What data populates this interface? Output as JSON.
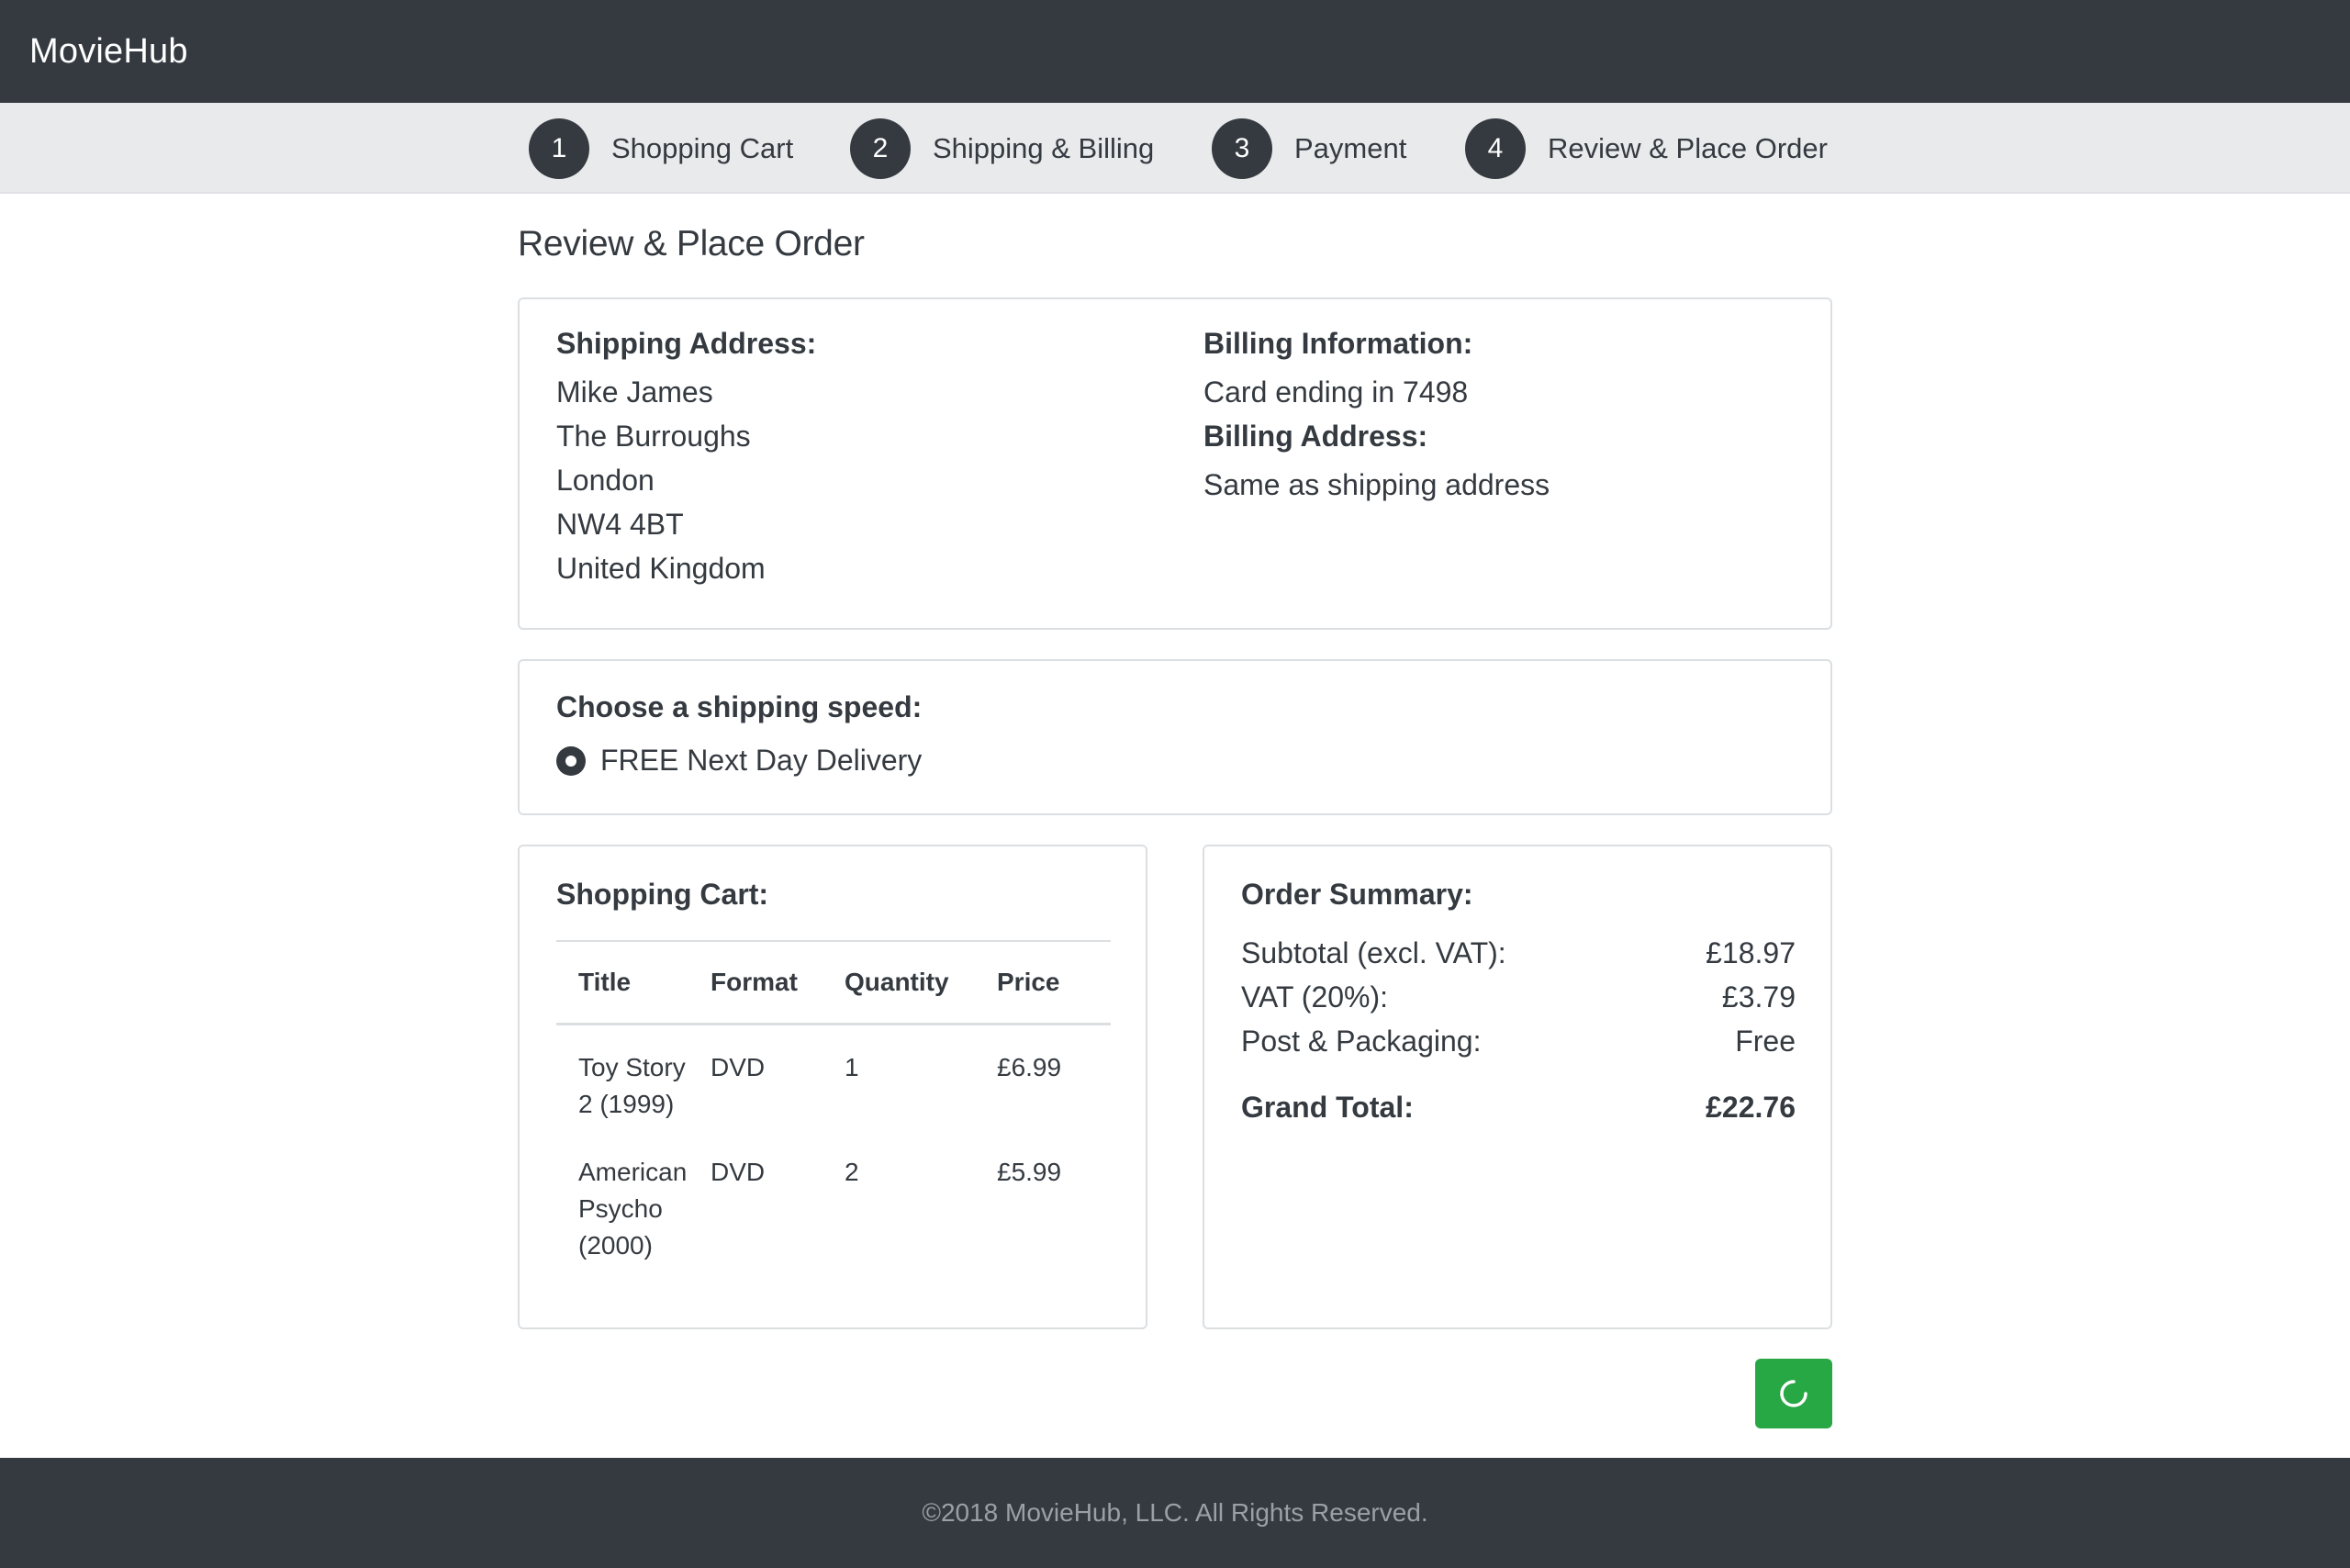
{
  "navbar": {
    "brand": "MovieHub"
  },
  "steps": [
    {
      "number": "1",
      "label": "Shopping Cart"
    },
    {
      "number": "2",
      "label": "Shipping & Billing"
    },
    {
      "number": "3",
      "label": "Payment"
    },
    {
      "number": "4",
      "label": "Review & Place Order"
    }
  ],
  "page": {
    "title": "Review & Place Order"
  },
  "shipping": {
    "heading": "Shipping Address:",
    "lines": [
      "Mike James",
      "The Burroughs",
      "London",
      "NW4 4BT",
      "United Kingdom"
    ]
  },
  "billing": {
    "heading": "Billing Information:",
    "card": "Card ending in 7498",
    "address_heading": "Billing Address:",
    "address": "Same as shipping address"
  },
  "speed": {
    "heading": "Choose a shipping speed:",
    "option": "FREE Next Day Delivery",
    "selected": true
  },
  "cart": {
    "heading": "Shopping Cart:",
    "columns": [
      "Title",
      "Format",
      "Quantity",
      "Price"
    ],
    "rows": [
      {
        "title_lines": [
          "Toy Story",
          "2 (1999)"
        ],
        "format": "DVD",
        "quantity": "1",
        "price": "£6.99"
      },
      {
        "title_lines": [
          "American",
          "Psycho",
          "(2000)"
        ],
        "format": "DVD",
        "quantity": "2",
        "price": "£5.99"
      }
    ]
  },
  "summary": {
    "heading": "Order Summary:",
    "rows": [
      {
        "label": "Subtotal (excl. VAT):",
        "value": "£18.97"
      },
      {
        "label": "VAT (20%):",
        "value": "£3.79"
      },
      {
        "label": "Post & Packaging:",
        "value": "Free"
      }
    ],
    "grand_label": "Grand Total:",
    "grand_value": "£22.76"
  },
  "place_order": {
    "icon": "loading-spinner-icon",
    "color": "#28a745"
  },
  "footer": {
    "text": "©2018 MovieHub, LLC. All Rights Reserved."
  },
  "colors": {
    "dark": "#343a40",
    "stepper_bg": "#e9eaec",
    "accent": "#28a745"
  }
}
